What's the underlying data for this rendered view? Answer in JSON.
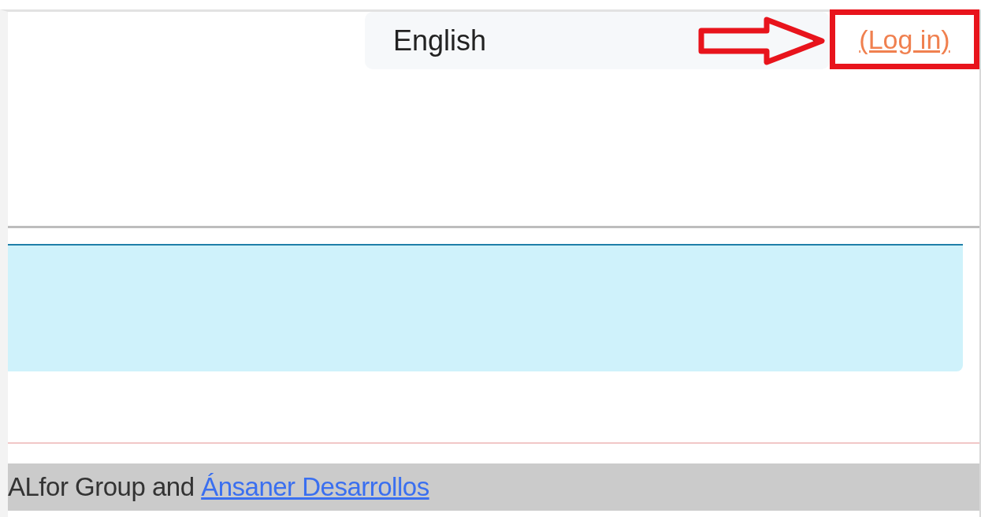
{
  "header": {
    "language": "English",
    "login": "(Log in)"
  },
  "alert": {
    "kind": "info"
  },
  "footer": {
    "text": "ALfor Group and",
    "link": "Ánsaner Desarrollos"
  }
}
